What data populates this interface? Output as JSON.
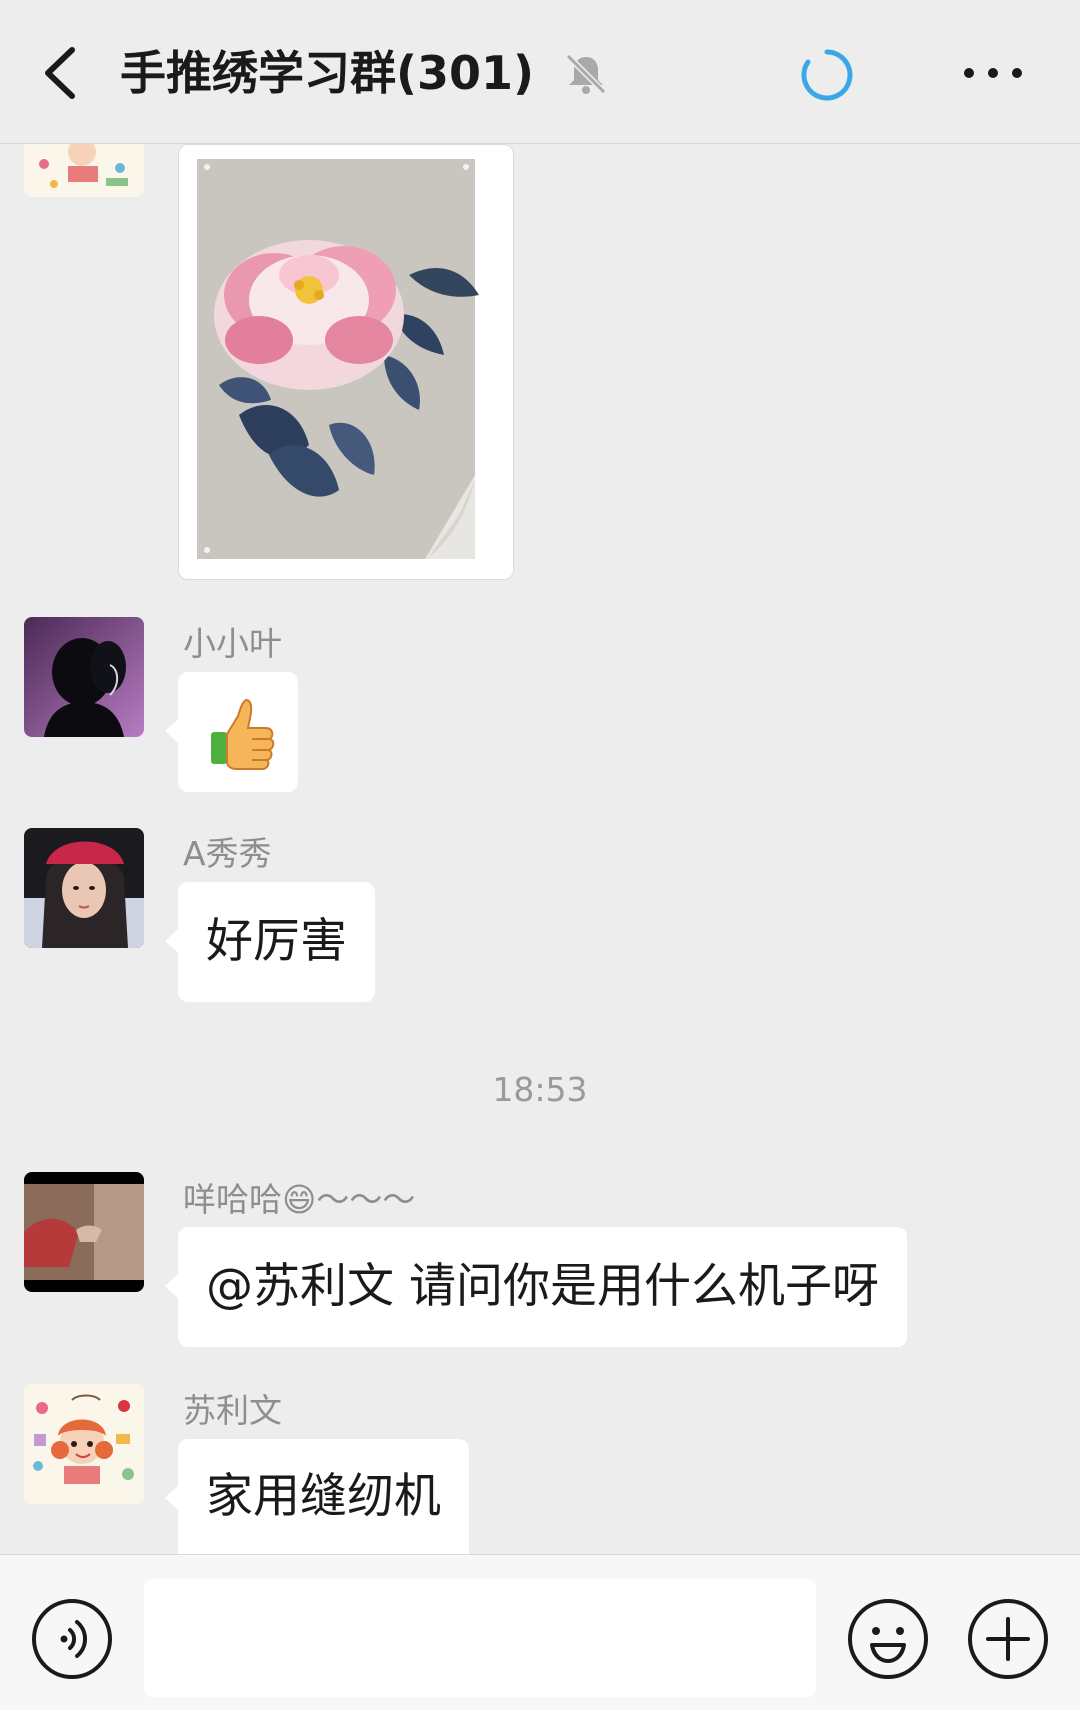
{
  "header": {
    "title": "手推绣学习群(301)",
    "icons": [
      "back-arrow-icon",
      "mute-bell-icon",
      "loading-icon",
      "more-icon"
    ]
  },
  "messages": [
    {
      "type": "image",
      "sender": "苏利文",
      "content": "embroidered-peony-image"
    },
    {
      "type": "emoji",
      "sender": "小小叶",
      "content": "thumbs-up"
    },
    {
      "type": "text",
      "sender": "A秀秀",
      "content": "好厉害"
    },
    {
      "type": "text",
      "sender": "咩哈哈😄～～～",
      "content": "@苏利文  请问你是用什么机子呀"
    },
    {
      "type": "text",
      "sender": "苏利文",
      "content": "家用缝纫机"
    }
  ],
  "timestamp": "18:53",
  "input_bar": {
    "value": "",
    "icons": [
      "voice-icon",
      "emoji-icon",
      "plus-icon"
    ]
  },
  "colors": {
    "background": "#ededed",
    "bubble": "#ffffff",
    "accent_blue": "#3aa8e8",
    "sender_name": "#8e8e8e"
  }
}
